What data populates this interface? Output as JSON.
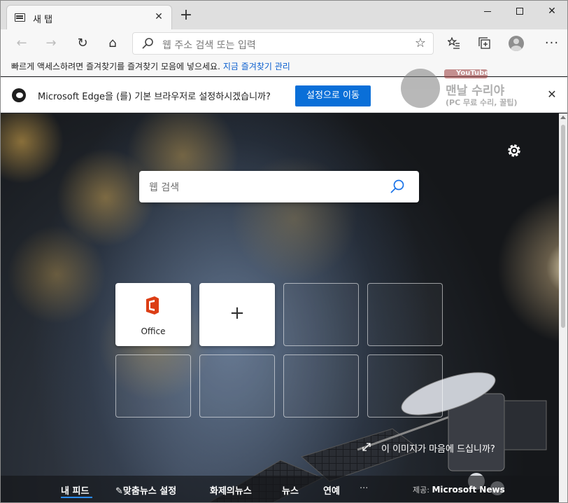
{
  "tab": {
    "title": "새 탭",
    "close": "✕",
    "new_tab": "+"
  },
  "window": {
    "minimize": "",
    "maximize": "",
    "close": "✕"
  },
  "toolbar": {
    "back": "←",
    "forward": "→",
    "refresh": "↻",
    "home": "⌂",
    "address_placeholder": "웹 주소 검색 또는 입력",
    "favorite_star": "☆",
    "more": "···"
  },
  "favorites_bar": {
    "text": "빠르게 액세스하려면 즐겨찾기를 즐겨찾기 모음에 넣으세요.",
    "link": "지금 즐겨찾기 관리"
  },
  "default_prompt": {
    "text": "Microsoft Edge을 (를) 기본 브라우저로 설정하시겠습니까?",
    "button": "설정으로 이동",
    "close": "✕"
  },
  "watermark": {
    "youtube": "YouTube",
    "line1": "맨날 수리야",
    "line2": "(PC 무료 수리, 꿀팁)"
  },
  "search": {
    "placeholder": "웹 검색"
  },
  "quick_links": [
    {
      "label": "Office",
      "icon": "office-icon"
    },
    {
      "label": "+",
      "icon": "add-icon"
    }
  ],
  "image_feedback": "이 이미지가 마음에 드십니까?",
  "bottom_nav": {
    "items": [
      "내 피드",
      "맞춤뉴스 설정",
      "화제의뉴스",
      "뉴스",
      "연예",
      "···"
    ],
    "source_prefix": "제공:",
    "source_name": "Microsoft News"
  },
  "colors": {
    "accent": "#0a6fd8",
    "link": "#0a5ecf",
    "active_underline": "#2b8cff"
  }
}
